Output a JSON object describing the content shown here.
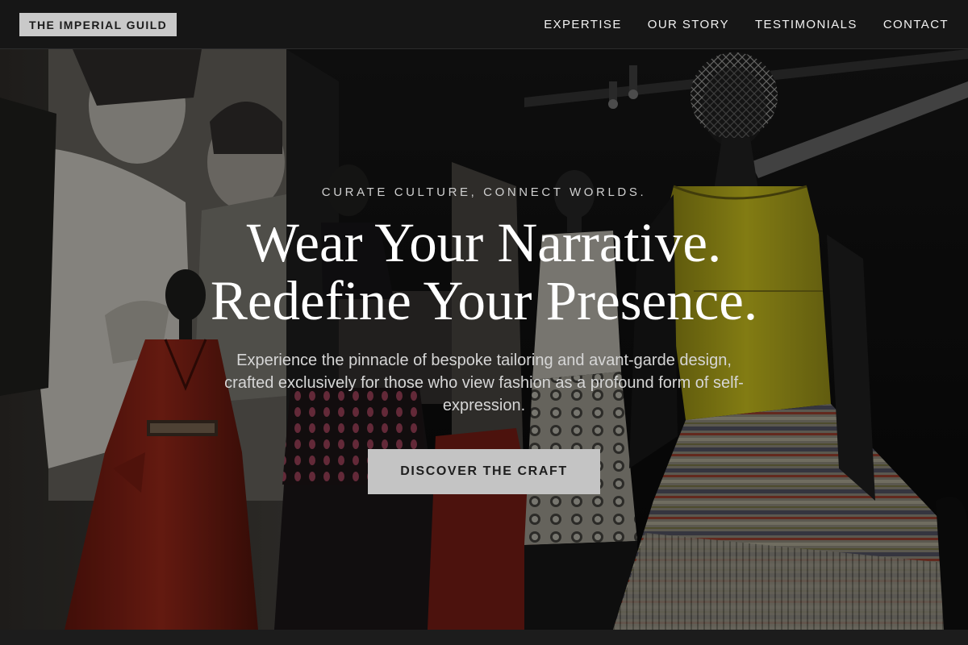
{
  "header": {
    "logo": "THE IMPERIAL GUILD",
    "nav": [
      "EXPERTISE",
      "OUR STORY",
      "TESTIMONIALS",
      "CONTACT"
    ]
  },
  "hero": {
    "tagline": "CURATE CULTURE, CONNECT WORLDS.",
    "headline_line1": "Wear Your Narrative.",
    "headline_line2": "Redefine Your Presence.",
    "subtext": "Experience the pinnacle of bespoke tailoring and avant-garde design, crafted exclusively for those who view fashion as a profound form of self-expression.",
    "cta_label": "DISCOVER THE CRAFT",
    "background": "photo of a fashion exhibition with mannequins in a red coat, a patterned dress and a yellow-and-striped pleated dress"
  },
  "colors": {
    "nav_bg": "#161616",
    "logo_bg": "#c9c9c9",
    "cta_bg": "#c4c4c4",
    "coat_red": "#8a2417",
    "dress_yellow": "#b5ac1b"
  }
}
